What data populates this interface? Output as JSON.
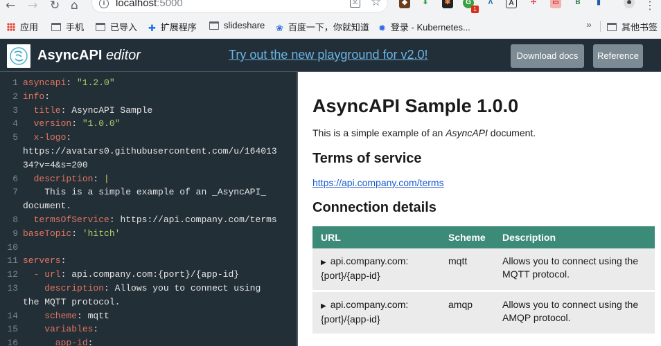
{
  "browser": {
    "url_host": "localhost",
    "url_port": ":5000",
    "bookmarks": [
      {
        "label": "应用"
      },
      {
        "label": "手机"
      },
      {
        "label": "已导入"
      },
      {
        "label": "扩展程序"
      },
      {
        "label": "slideshare"
      },
      {
        "label": "百度一下，你就知道"
      },
      {
        "label": "登录 - Kubernetes..."
      }
    ],
    "bookmarks_more": "»",
    "other_bookmarks": "其他书签",
    "ext_badge_count": "1"
  },
  "header": {
    "title_bold": "AsyncAPI",
    "title_italic": "editor",
    "promo_link": "Try out the new playground for v2.0!",
    "download_btn": "Download docs",
    "reference_btn": "Reference"
  },
  "editor": {
    "lines": [
      {
        "n": "1",
        "key": "asyncapi",
        "sep": ": ",
        "val": "\"1.2.0\""
      },
      {
        "n": "2",
        "key": "info",
        "sep": ":",
        "val": ""
      },
      {
        "n": "3",
        "key": "  title",
        "sep": ": ",
        "val": "AsyncAPI Sample"
      },
      {
        "n": "4",
        "key": "  version",
        "sep": ": ",
        "val": "\"1.0.0\""
      },
      {
        "n": "5",
        "key": "  x-logo",
        "sep": ":",
        "val": ""
      },
      {
        "n": "",
        "key": "",
        "sep": "",
        "val": "https://avatars0.githubusercontent.com/u/164013"
      },
      {
        "n": "",
        "key": "",
        "sep": "",
        "val": "34?v=4&s=200"
      },
      {
        "n": "6",
        "key": "  description",
        "sep": ": ",
        "val": "|"
      },
      {
        "n": "7",
        "key": "",
        "sep": "",
        "val": "    This is a simple example of an _AsyncAPI_"
      },
      {
        "n": "",
        "key": "",
        "sep": "",
        "val": "document."
      },
      {
        "n": "8",
        "key": "  termsOfService",
        "sep": ": ",
        "val": "https://api.company.com/terms"
      },
      {
        "n": "9",
        "key": "baseTopic",
        "sep": ": ",
        "val": "'hitch'"
      },
      {
        "n": "10",
        "key": "",
        "sep": "",
        "val": ""
      },
      {
        "n": "11",
        "key": "servers",
        "sep": ":",
        "val": ""
      },
      {
        "n": "12",
        "key": "  - url",
        "sep": ": ",
        "val": "api.company.com:{port}/{app-id}"
      },
      {
        "n": "13",
        "key": "    description",
        "sep": ": ",
        "val": "Allows you to connect using"
      },
      {
        "n": "",
        "key": "",
        "sep": "",
        "val": "the MQTT protocol."
      },
      {
        "n": "14",
        "key": "    scheme",
        "sep": ": ",
        "val": "mqtt"
      },
      {
        "n": "15",
        "key": "    variables",
        "sep": ":",
        "val": ""
      },
      {
        "n": "16",
        "key": "      app-id",
        "sep": ":",
        "val": ""
      }
    ]
  },
  "docs": {
    "title": "AsyncAPI Sample 1.0.0",
    "desc_pre": "This is a simple example of an ",
    "desc_em": "AsyncAPI",
    "desc_post": " document.",
    "terms_heading": "Terms of service",
    "terms_link": "https://api.company.com/terms",
    "conn_heading": "Connection details",
    "table": {
      "headers": [
        "URL",
        "Scheme",
        "Description"
      ],
      "rows": [
        {
          "url_1": "api.company.com:",
          "url_2": "{port}/{app-id}",
          "scheme": "mqtt",
          "desc_1": "Allows you to connect using the",
          "desc_2": "MQTT protocol."
        },
        {
          "url_1": "api.company.com:",
          "url_2": "{port}/{app-id}",
          "scheme": "amqp",
          "desc_1": "Allows you to connect using the",
          "desc_2": "AMQP protocol."
        }
      ]
    }
  },
  "colors": {
    "header_bg": "#222f38",
    "editor_bg": "#232f37",
    "table_header": "#3c8a78",
    "link": "#1a5cd1"
  }
}
